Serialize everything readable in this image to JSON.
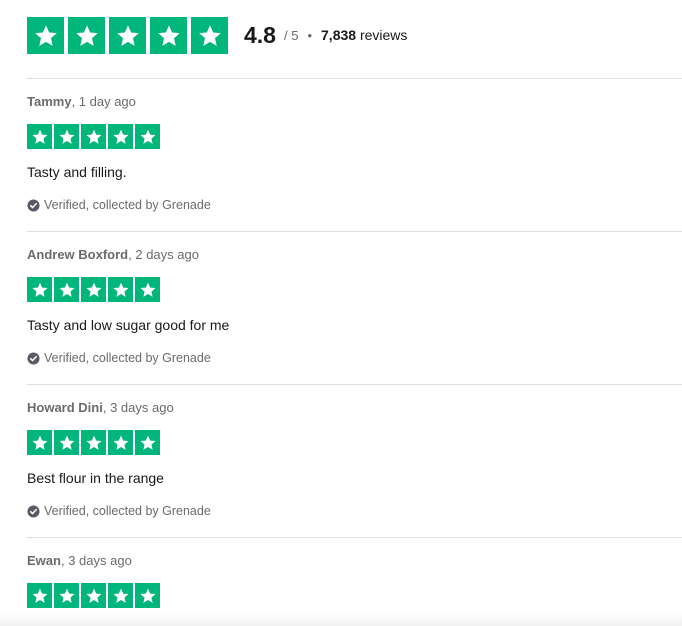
{
  "summary": {
    "score": "4.8",
    "out_of": "/ 5",
    "separator": "•",
    "review_count": "7,838",
    "reviews_label": "reviews",
    "star_count": 5
  },
  "colors": {
    "star_green": "#00b67a",
    "text_dark": "#191919",
    "text_muted": "#6b6b6b",
    "divider": "#dcdce6"
  },
  "reviews": [
    {
      "name": "Tammy",
      "time": ", 1 day ago",
      "rating": 5,
      "text": "Tasty and filling.",
      "verified": "Verified, collected by Grenade"
    },
    {
      "name": "Andrew Boxford",
      "time": ", 2 days ago",
      "rating": 5,
      "text": "Tasty and low sugar good for me",
      "verified": "Verified, collected by Grenade"
    },
    {
      "name": "Howard Dini",
      "time": ", 3 days ago",
      "rating": 5,
      "text": "Best flour in the range",
      "verified": "Verified, collected by Grenade"
    },
    {
      "name": "Ewan",
      "time": ", 3 days ago",
      "rating": 5,
      "text": "",
      "verified": ""
    }
  ]
}
